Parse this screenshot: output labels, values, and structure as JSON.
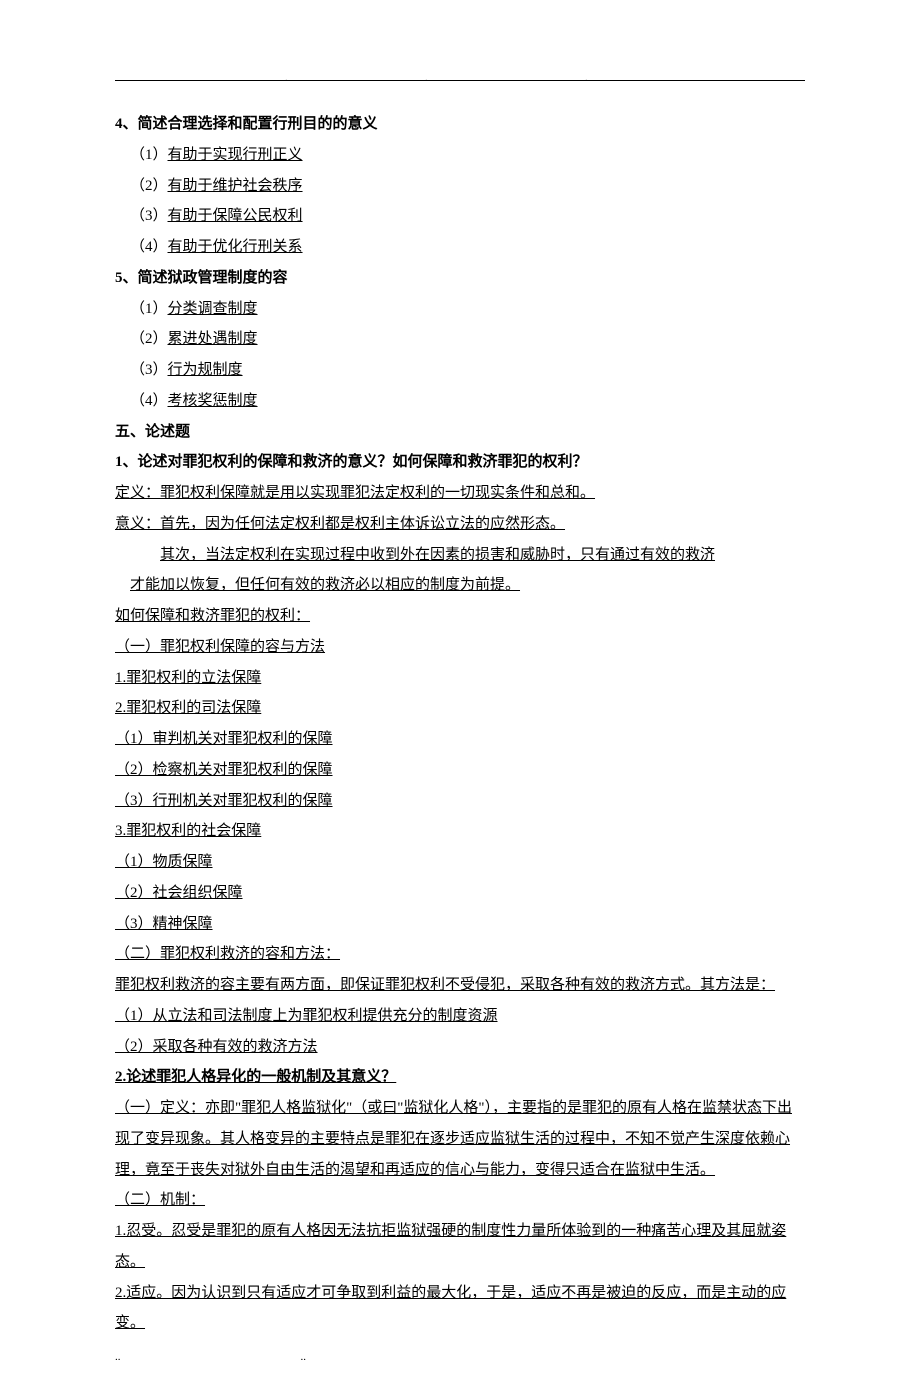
{
  "q4": {
    "title": "4、简述合理选择和配置行刑目的的意义",
    "items": [
      {
        "num": "（1）",
        "text": "有助于实现行刑正义"
      },
      {
        "num": "（2）",
        "text": "有助于维护社会秩序"
      },
      {
        "num": "（3）",
        "text": "有助于保障公民权利"
      },
      {
        "num": "（4）",
        "text": "有助于优化行刑关系"
      }
    ]
  },
  "q5": {
    "title": "5、简述狱政管理制度的容",
    "items": [
      {
        "num": "（1）",
        "text": "分类调查制度"
      },
      {
        "num": "（2）",
        "text": "累进处遇制度"
      },
      {
        "num": "（3）",
        "text": "行为规制度"
      },
      {
        "num": "（4）",
        "text": "考核奖惩制度"
      }
    ]
  },
  "section5": {
    "title": "五、论述题"
  },
  "essay1": {
    "title": "1、论述对罪犯权利的保障和救济的意义？如何保障和救济罪犯的权利？",
    "def": "定义：罪犯权利保障就是用以实现罪犯法定权利的一切现实条件和总和。",
    "m1": "意义：首先，因为任何法定权利都是权利主体诉讼立法的应然形态。",
    "m2": "其次，当法定权利在实现过程中收到外在因素的损害和威胁时，只有通过有效的救济",
    "m3": "才能加以恢复，但任何有效的救济必以相应的制度为前提。",
    "how": "如何保障和救济罪犯的权利：",
    "a_head": "（一）罪犯权利保障的容与方法",
    "a1": " 1.罪犯权利的立法保障 ",
    "a2": " 2.罪犯权利的司法保障 ",
    "a2_1": "（1）审判机关对罪犯权利的保障",
    "a2_2": "（2）检察机关对罪犯权利的保障",
    "a2_3": "（3）行刑机关对罪犯权利的保障",
    "a3": " 3.罪犯权利的社会保障   ",
    "a3_1": "（1）物质保障",
    "a3_2": "（2）社会组织保障",
    "a3_3": "（3）精神保障",
    "b_head": "（二）罪犯权利救济的容和方法：",
    "b_body": "罪犯权利救济的容主要有两方面，即保证罪犯权利不受侵犯，采取各种有效的救济方式。其方法是：",
    "b1": "（1）从立法和司法制度上为罪犯权利提供充分的制度资源    ",
    "b2": "（2）采取各种有效的救济方法"
  },
  "essay2": {
    "title": "2.论述罪犯人格异化的一般机制及其意义？",
    "def": "（一）定义：亦即\"罪犯人格监狱化\"（或曰\"监狱化人格\"），主要指的是罪犯的原有人格在监禁状态下出现了变异现象。其人格变异的主要特点是罪犯在逐步适应监狱生活的过程中，不知不觉产生深度依赖心理，竟至于丧失对狱外自由生活的渴望和再适应的信心与能力，变得只适合在监狱中生活。",
    "mech_head": "（二）机制：",
    "mech1": " 1.忍受。忍受是罪犯的原有人格因无法抗拒监狱强硬的制度性力量所体验到的一种痛苦心理及其屈就姿态。",
    "mech2": " 2.适应。因为认识到只有适应才可争取到利益的最大化，于是，适应不再是被迫的反应，而是主动的应变。"
  }
}
